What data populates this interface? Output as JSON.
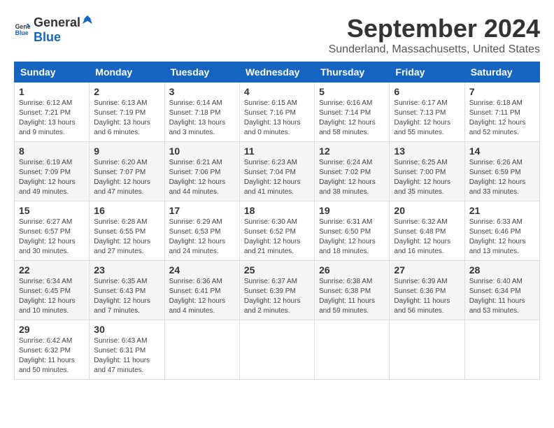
{
  "logo": {
    "general": "General",
    "blue": "Blue"
  },
  "title": "September 2024",
  "location": "Sunderland, Massachusetts, United States",
  "days_of_week": [
    "Sunday",
    "Monday",
    "Tuesday",
    "Wednesday",
    "Thursday",
    "Friday",
    "Saturday"
  ],
  "weeks": [
    [
      {
        "day": "1",
        "sunrise": "6:12 AM",
        "sunset": "7:21 PM",
        "daylight": "13 hours and 9 minutes."
      },
      {
        "day": "2",
        "sunrise": "6:13 AM",
        "sunset": "7:19 PM",
        "daylight": "13 hours and 6 minutes."
      },
      {
        "day": "3",
        "sunrise": "6:14 AM",
        "sunset": "7:18 PM",
        "daylight": "13 hours and 3 minutes."
      },
      {
        "day": "4",
        "sunrise": "6:15 AM",
        "sunset": "7:16 PM",
        "daylight": "13 hours and 0 minutes."
      },
      {
        "day": "5",
        "sunrise": "6:16 AM",
        "sunset": "7:14 PM",
        "daylight": "12 hours and 58 minutes."
      },
      {
        "day": "6",
        "sunrise": "6:17 AM",
        "sunset": "7:13 PM",
        "daylight": "12 hours and 55 minutes."
      },
      {
        "day": "7",
        "sunrise": "6:18 AM",
        "sunset": "7:11 PM",
        "daylight": "12 hours and 52 minutes."
      }
    ],
    [
      {
        "day": "8",
        "sunrise": "6:19 AM",
        "sunset": "7:09 PM",
        "daylight": "12 hours and 49 minutes."
      },
      {
        "day": "9",
        "sunrise": "6:20 AM",
        "sunset": "7:07 PM",
        "daylight": "12 hours and 47 minutes."
      },
      {
        "day": "10",
        "sunrise": "6:21 AM",
        "sunset": "7:06 PM",
        "daylight": "12 hours and 44 minutes."
      },
      {
        "day": "11",
        "sunrise": "6:23 AM",
        "sunset": "7:04 PM",
        "daylight": "12 hours and 41 minutes."
      },
      {
        "day": "12",
        "sunrise": "6:24 AM",
        "sunset": "7:02 PM",
        "daylight": "12 hours and 38 minutes."
      },
      {
        "day": "13",
        "sunrise": "6:25 AM",
        "sunset": "7:00 PM",
        "daylight": "12 hours and 35 minutes."
      },
      {
        "day": "14",
        "sunrise": "6:26 AM",
        "sunset": "6:59 PM",
        "daylight": "12 hours and 33 minutes."
      }
    ],
    [
      {
        "day": "15",
        "sunrise": "6:27 AM",
        "sunset": "6:57 PM",
        "daylight": "12 hours and 30 minutes."
      },
      {
        "day": "16",
        "sunrise": "6:28 AM",
        "sunset": "6:55 PM",
        "daylight": "12 hours and 27 minutes."
      },
      {
        "day": "17",
        "sunrise": "6:29 AM",
        "sunset": "6:53 PM",
        "daylight": "12 hours and 24 minutes."
      },
      {
        "day": "18",
        "sunrise": "6:30 AM",
        "sunset": "6:52 PM",
        "daylight": "12 hours and 21 minutes."
      },
      {
        "day": "19",
        "sunrise": "6:31 AM",
        "sunset": "6:50 PM",
        "daylight": "12 hours and 18 minutes."
      },
      {
        "day": "20",
        "sunrise": "6:32 AM",
        "sunset": "6:48 PM",
        "daylight": "12 hours and 16 minutes."
      },
      {
        "day": "21",
        "sunrise": "6:33 AM",
        "sunset": "6:46 PM",
        "daylight": "12 hours and 13 minutes."
      }
    ],
    [
      {
        "day": "22",
        "sunrise": "6:34 AM",
        "sunset": "6:45 PM",
        "daylight": "12 hours and 10 minutes."
      },
      {
        "day": "23",
        "sunrise": "6:35 AM",
        "sunset": "6:43 PM",
        "daylight": "12 hours and 7 minutes."
      },
      {
        "day": "24",
        "sunrise": "6:36 AM",
        "sunset": "6:41 PM",
        "daylight": "12 hours and 4 minutes."
      },
      {
        "day": "25",
        "sunrise": "6:37 AM",
        "sunset": "6:39 PM",
        "daylight": "12 hours and 2 minutes."
      },
      {
        "day": "26",
        "sunrise": "6:38 AM",
        "sunset": "6:38 PM",
        "daylight": "11 hours and 59 minutes."
      },
      {
        "day": "27",
        "sunrise": "6:39 AM",
        "sunset": "6:36 PM",
        "daylight": "11 hours and 56 minutes."
      },
      {
        "day": "28",
        "sunrise": "6:40 AM",
        "sunset": "6:34 PM",
        "daylight": "11 hours and 53 minutes."
      }
    ],
    [
      {
        "day": "29",
        "sunrise": "6:42 AM",
        "sunset": "6:32 PM",
        "daylight": "11 hours and 50 minutes."
      },
      {
        "day": "30",
        "sunrise": "6:43 AM",
        "sunset": "6:31 PM",
        "daylight": "11 hours and 47 minutes."
      },
      null,
      null,
      null,
      null,
      null
    ]
  ]
}
